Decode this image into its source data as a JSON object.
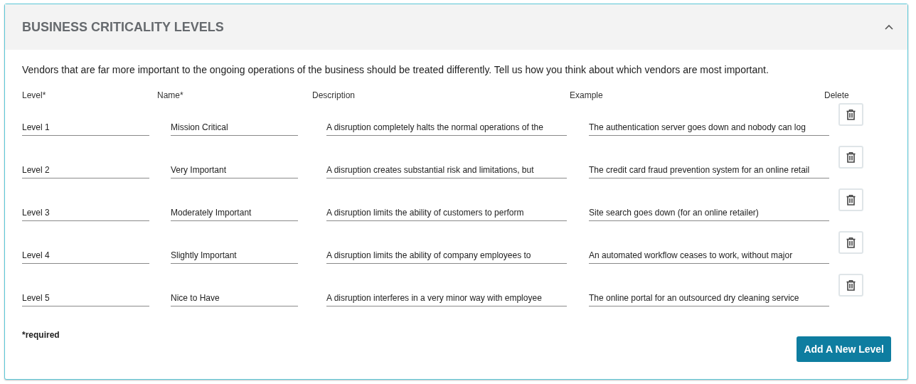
{
  "panel": {
    "title": "BUSINESS CRITICALITY LEVELS",
    "expanded": true
  },
  "intro": "Vendors that are far more important to the ongoing operations of the business should be treated differently. Tell us how you think about which vendors are most important.",
  "columns": [
    "Level*",
    "Name*",
    "Description",
    "Example",
    "Delete"
  ],
  "rows": [
    {
      "level": "Level 1",
      "name": "Mission Critical",
      "description": "A disruption completely halts the normal operations of the",
      "example": "The authentication server goes down and nobody can log"
    },
    {
      "level": "Level 2",
      "name": "Very Important",
      "description": "A disruption creates substantial risk and limitations, but",
      "example": "The credit card fraud prevention system for an online retail"
    },
    {
      "level": "Level 3",
      "name": "Moderately Important",
      "description": "A disruption limits the ability of customers to perform",
      "example": "Site search goes down (for an online retailer)"
    },
    {
      "level": "Level 4",
      "name": "Slightly Important",
      "description": "A disruption limits the ability of company employees to",
      "example": "An automated workflow ceases to work, without major"
    },
    {
      "level": "Level 5",
      "name": "Nice to Have",
      "description": "A disruption interferes in a very minor way with employee",
      "example": "The online portal for an outsourced dry cleaning service"
    }
  ],
  "required_note": "*required",
  "add_button": "Add A New Level"
}
